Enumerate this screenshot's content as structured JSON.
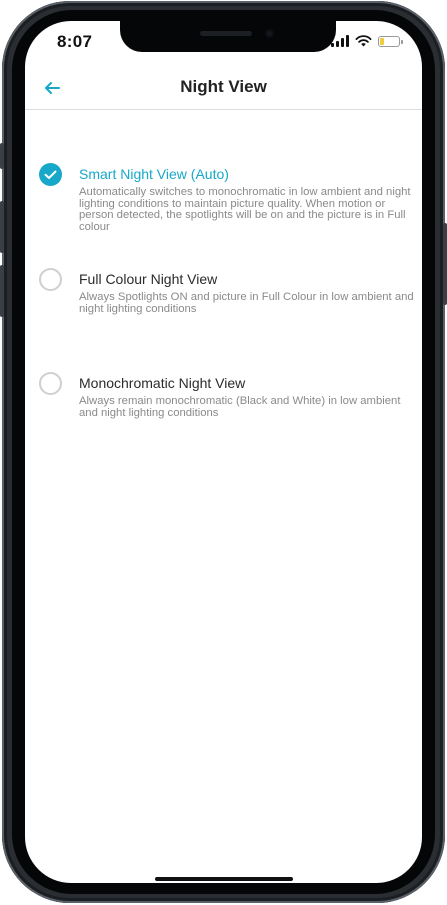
{
  "status_bar": {
    "time": "8:07",
    "battery_level": 0.2
  },
  "header": {
    "title": "Night View",
    "back_icon": "arrow-left-icon"
  },
  "colors": {
    "accent": "#17a8c9"
  },
  "options": [
    {
      "label": "Smart Night View (Auto)",
      "description": "Automatically switches to monochromatic in low ambient and night lighting conditions to maintain picture quality. When motion or person detected, the spotlights will be on and the picture is in Full colour",
      "selected": true
    },
    {
      "label": "Full Colour Night View",
      "description": "Always Spotlights ON and picture in Full Colour in low ambient and night lighting conditions",
      "selected": false
    },
    {
      "label": "Monochromatic Night View",
      "description": "Always remain monochromatic (Black and White) in low ambient and night lighting conditions",
      "selected": false
    }
  ]
}
